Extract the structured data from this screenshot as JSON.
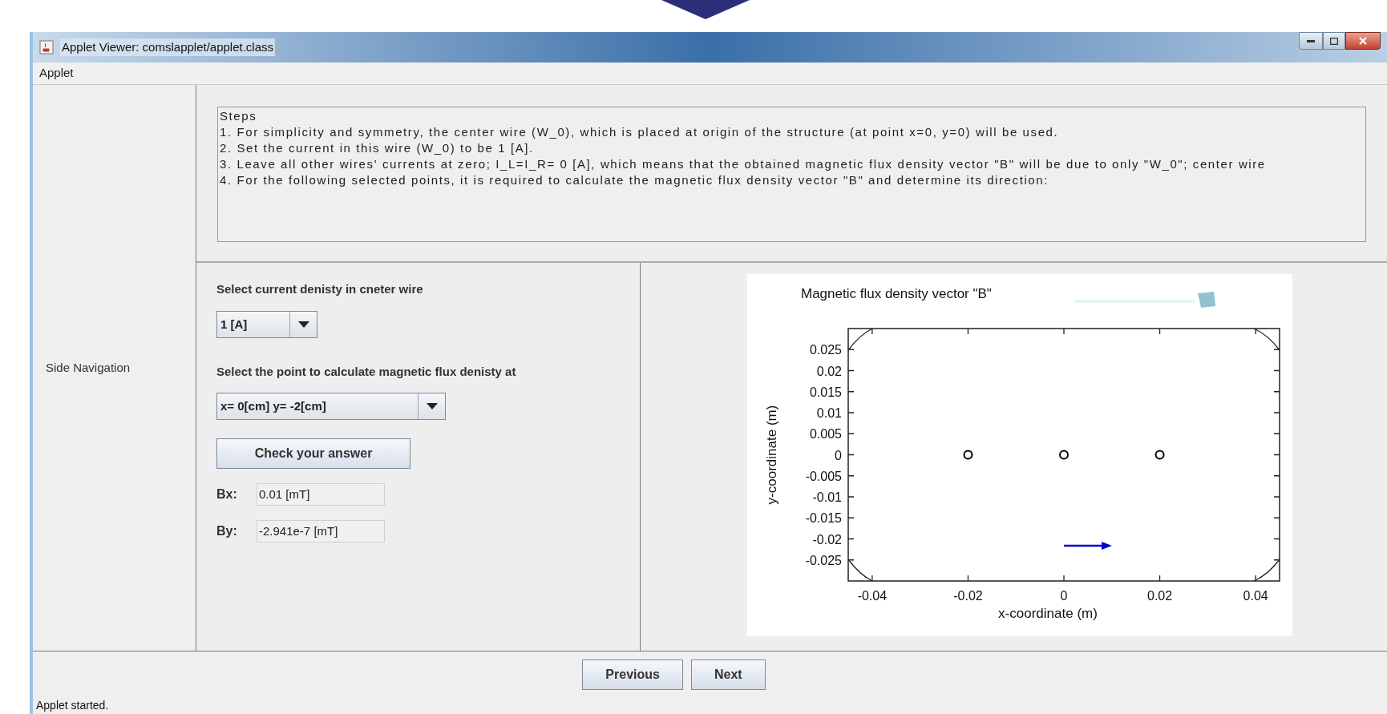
{
  "window": {
    "title": "Applet Viewer: comslapplet/applet.class"
  },
  "menu": [
    "Applet"
  ],
  "side_navigation": {
    "label": "Side Navigation"
  },
  "steps": {
    "title": "Steps",
    "lines": [
      "1. For simplicity and symmetry, the center wire (W_0), which is placed at origin of the structure (at point x=0, y=0) will be used.",
      "2. Set the current in this wire (W_0) to be 1 [A].",
      "3. Leave all other wires' currents at zero; I_L=I_R= 0 [A], which means that the obtained magnetic flux density vector \"B\" will be due to only \"W_0\"; center wire",
      "4. For the following selected points, it is required to calculate the magnetic flux density vector \"B\" and determine its direction:"
    ]
  },
  "controls": {
    "current_label": "Select current denisty in cneter wire",
    "current_select": {
      "value": "1 [A]"
    },
    "point_label": "Select the point to calculate magnetic flux denisty at",
    "point_select": {
      "value": "x= 0[cm] y= -2[cm]"
    },
    "check_button": "Check your answer",
    "results": [
      {
        "label": "Bx:",
        "value": "0.01 [mT]"
      },
      {
        "label": "By:",
        "value": "-2.941e-7 [mT]"
      }
    ]
  },
  "chart": {
    "chart_data": {
      "type": "scatter",
      "title": "Magnetic flux density vector \"B\"",
      "xlabel": "x-coordinate (m)",
      "ylabel": "y-coordinate (m)",
      "x": [
        -0.02,
        0,
        0.02
      ],
      "series": [
        {
          "color": "#000000",
          "values": [
            0,
            0,
            0
          ]
        }
      ],
      "xlim": [
        -0.045,
        0.045
      ],
      "ylim": [
        -0.03,
        0.03
      ],
      "xticks": [
        -0.04,
        -0.02,
        0,
        0.02,
        0.04
      ],
      "yticks": [
        0.025,
        0.02,
        0.015,
        0.01,
        0.005,
        0,
        -0.005,
        -0.01,
        -0.015,
        -0.02,
        -0.025
      ]
    }
  },
  "buttons": [
    "Previous",
    "Next"
  ],
  "status_bar": "Applet started."
}
